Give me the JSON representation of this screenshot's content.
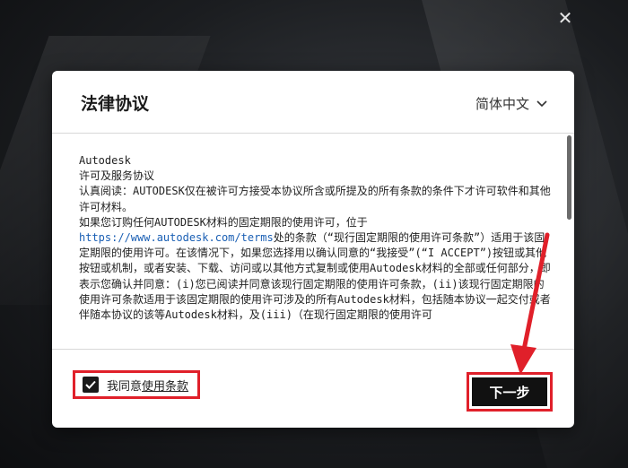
{
  "window": {
    "close_glyph": "✕"
  },
  "dialog": {
    "title": "法律协议",
    "language": "简体中文",
    "agreement_lines": [
      "Autodesk",
      "许可及服务协议",
      "认真阅读：AUTODESK仅在被许可方接受本协议所含或所提及的所有条款的条件下才许可软件和其他许可材料。",
      "如果您订购任何AUTODESK材料的固定期限的使用许可，位于"
    ],
    "link_text": "https://www.autodesk.com/terms",
    "after_link_text": "处的条款（“现行固定期限的使用许可条款”）适用于该固定期限的使用许可。在该情况下，如果您选择用以确认同意的“我接受”(“I ACCEPT”)按钮或其他按钮或机制，或者安装、下载、访问或以其他方式复制或使用Autodesk材料的全部或任何部分，即表示您确认并同意：(i)您已阅读并同意该现行固定期限的使用许可条款，(ii)该现行固定期限的使用许可条款适用于该固定期限的使用许可涉及的所有Autodesk材料，包括随本协议一起交付或者伴随本协议的该等Autodesk材料，及(iii)（在现行固定期限的使用许可",
    "agree_prefix": "我同意",
    "agree_link": "使用条款",
    "agree_checked": true,
    "next_button": "下一步"
  },
  "colors": {
    "highlight": "#e0202a",
    "link": "#1a5fb4",
    "button": "#111111"
  }
}
